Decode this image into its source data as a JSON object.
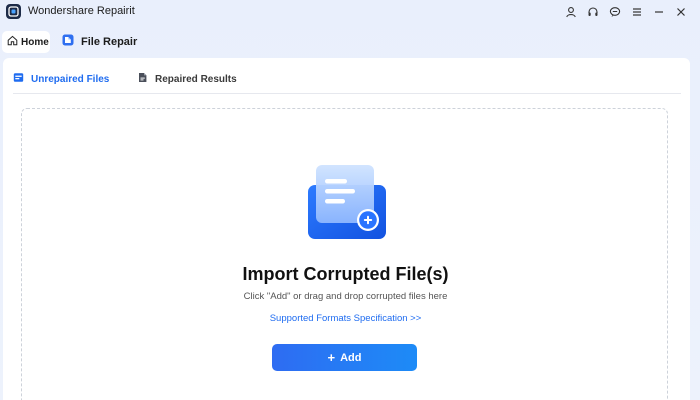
{
  "app": {
    "title": "Wondershare Repairit",
    "window_controls": [
      "account-icon",
      "headset-icon",
      "chat-icon",
      "menu-icon",
      "minimize-icon",
      "close-icon"
    ]
  },
  "nav": {
    "home_label": "Home",
    "section_label": "File Repair"
  },
  "tabs": [
    {
      "label": "Unrepaired Files",
      "active": true
    },
    {
      "label": "Repaired Results",
      "active": false
    }
  ],
  "import": {
    "title": "Import Corrupted File(s)",
    "subtitle": "Click \"Add\" or drag and drop corrupted files here",
    "formats_link": "Supported Formats Specification >>",
    "add_button": "Add",
    "add_button_icon": "+"
  },
  "colors": {
    "accent": "#1f6cf0",
    "button_start": "#2e6cf2",
    "button_end": "#1d8bf7",
    "background": "#e9effc"
  }
}
